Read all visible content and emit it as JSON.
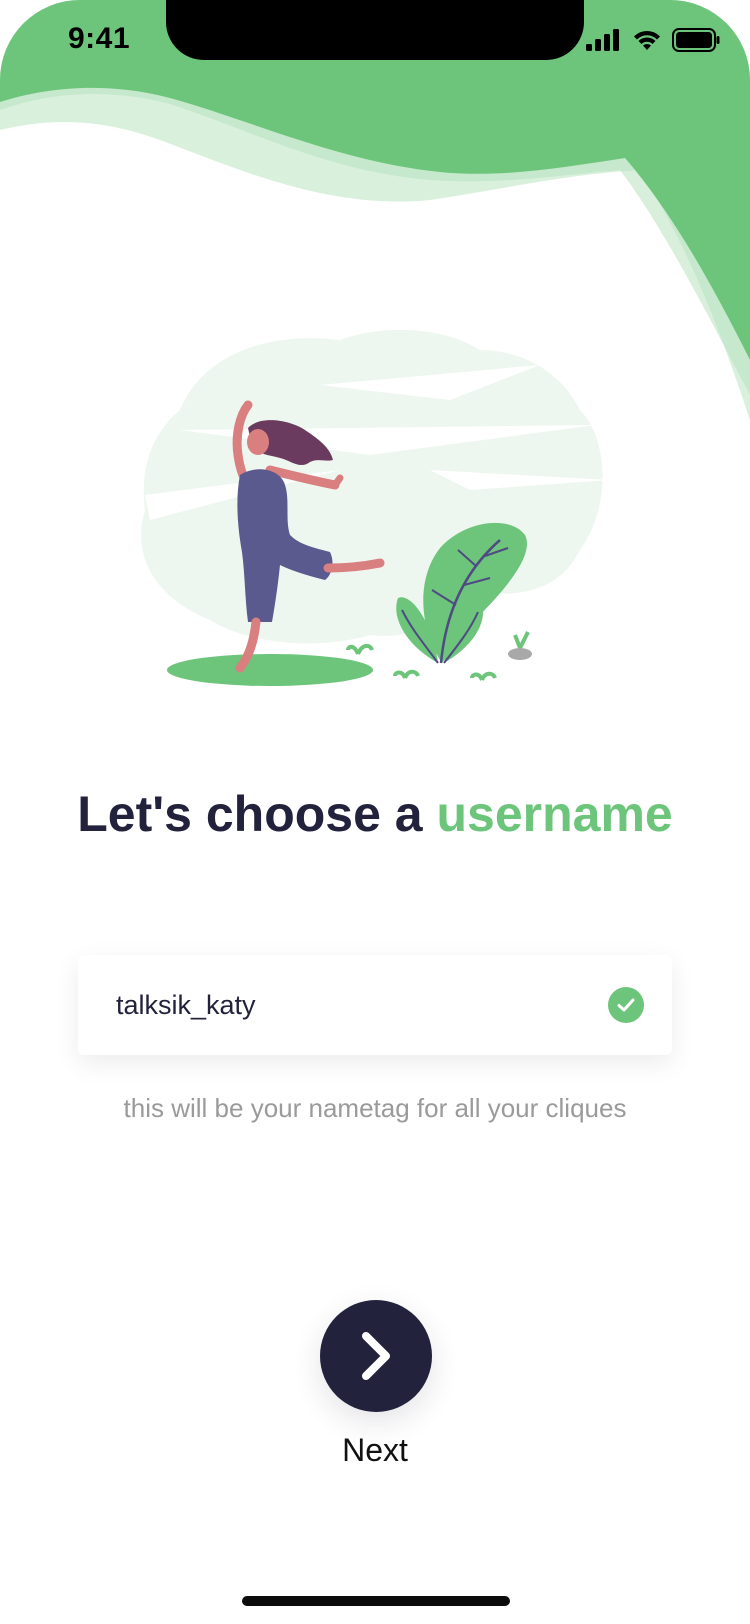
{
  "status_bar": {
    "time": "9:41",
    "icons": [
      "signal-icon",
      "wifi-icon",
      "battery-icon"
    ]
  },
  "title": {
    "prefix": "Let's choose a ",
    "accent": "username"
  },
  "username_field": {
    "value": "talksik_katy",
    "valid": true,
    "status_icon": "check-circle-icon"
  },
  "helper_text": "this will be your nametag for all your cliques",
  "next_button": {
    "icon": "chevron-right-icon",
    "label": "Next"
  },
  "colors": {
    "accent": "#6cc57a",
    "accent_light": "#d6eed9",
    "dark": "#23223d",
    "muted_text": "#9a9a9a",
    "background": "#ffffff"
  }
}
